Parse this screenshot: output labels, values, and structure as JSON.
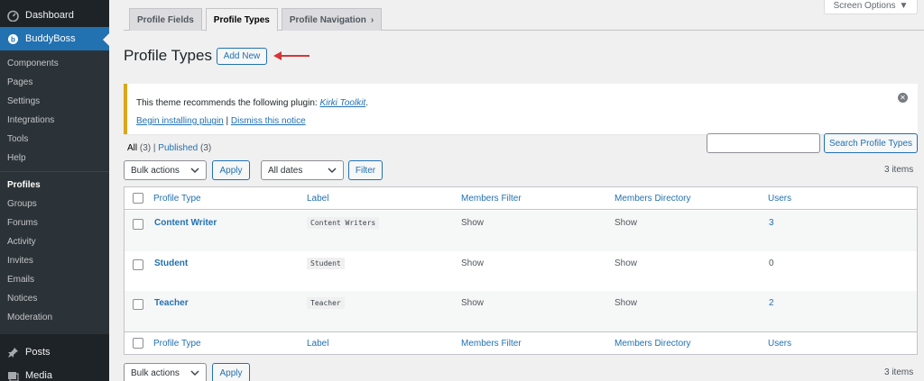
{
  "sidebar": {
    "dashboard": "Dashboard",
    "buddyboss": "BuddyBoss",
    "submenu": [
      "Components",
      "Pages",
      "Settings",
      "Integrations",
      "Tools",
      "Help",
      "Profiles",
      "Groups",
      "Forums",
      "Activity",
      "Invites",
      "Emails",
      "Notices",
      "Moderation"
    ],
    "posts": "Posts",
    "media": "Media"
  },
  "tabs": [
    "Profile Fields",
    "Profile Types",
    "Profile Navigation"
  ],
  "screen_options": "Screen Options",
  "heading": {
    "title": "Profile Types",
    "add_new": "Add New"
  },
  "notice": {
    "text": "This theme recommends the following plugin: ",
    "plugin": "Kirki Toolkit",
    "suffix": ".",
    "begin": "Begin installing plugin",
    "separator": " | ",
    "dismiss": "Dismiss this notice"
  },
  "views": {
    "all": "All",
    "all_count": "(3)",
    "sep": " | ",
    "published": "Published",
    "published_count": "(3)"
  },
  "search": {
    "button": "Search Profile Types",
    "placeholder": ""
  },
  "tablenav": {
    "bulk": "Bulk actions",
    "apply": "Apply",
    "dates": "All dates",
    "filter": "Filter",
    "items": "3 items"
  },
  "table": {
    "columns": [
      "Profile Type",
      "Label",
      "Members Filter",
      "Members Directory",
      "Users"
    ],
    "rows": [
      {
        "title": "Content Writer",
        "label": "Content Writers",
        "filter": "Show",
        "directory": "Show",
        "users": "3"
      },
      {
        "title": "Student",
        "label": "Student",
        "filter": "Show",
        "directory": "Show",
        "users": "0"
      },
      {
        "title": "Teacher",
        "label": "Teacher",
        "filter": "Show",
        "directory": "Show",
        "users": "2"
      }
    ]
  },
  "colors": {
    "sidebar": "#1d2327",
    "accent": "#2271b1",
    "notice_border": "#dba617",
    "arrow": "#d63638"
  }
}
